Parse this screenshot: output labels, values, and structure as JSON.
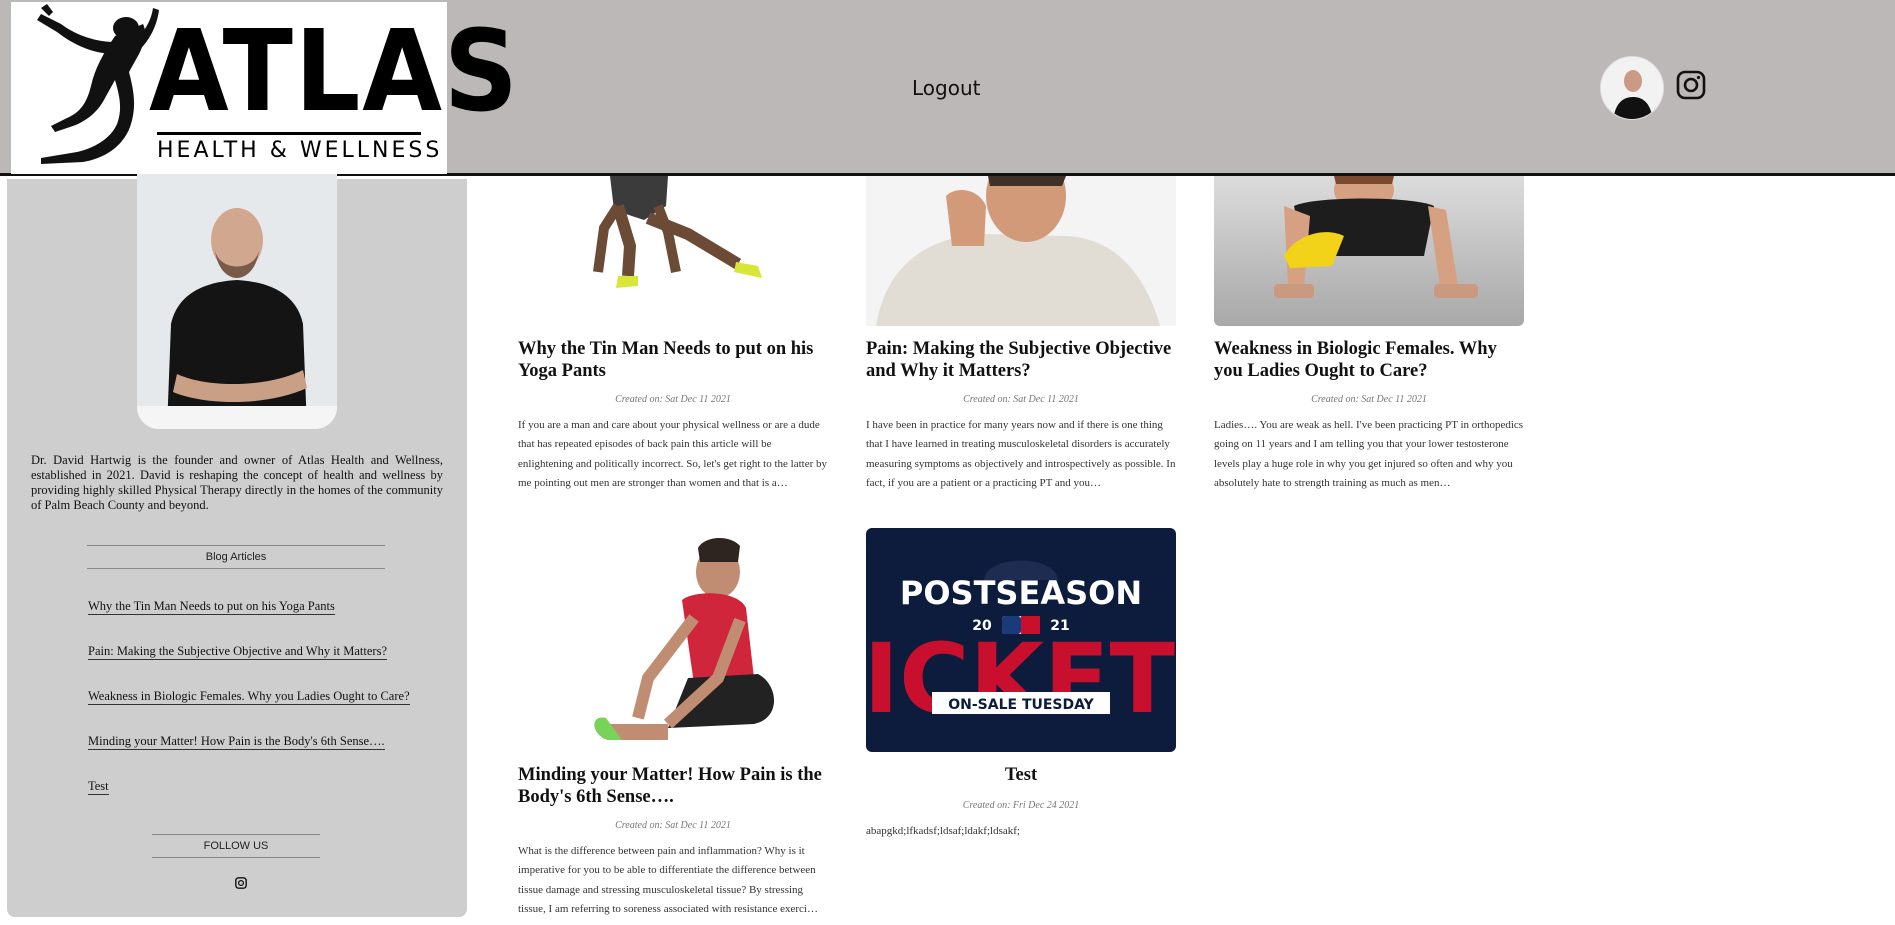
{
  "brand": {
    "name": "ATLAS",
    "tagline": "HEALTH & WELLNESS"
  },
  "header": {
    "logout_label": "Logout",
    "avatar_icon": "profile-avatar",
    "instagram_icon": "instagram-icon"
  },
  "sidebar": {
    "bio": "Dr. David Hartwig is the founder and owner of Atlas Health and Wellness, established in 2021. David is reshaping the concept of health and wellness by providing highly skilled Physical Therapy directly in the homes of the community of Palm Beach County and beyond.",
    "blog_label": "Blog Articles",
    "links": [
      "Why the Tin Man Needs to put on his Yoga Pants",
      "Pain: Making the Subjective Objective and Why it Matters?",
      "Weakness in Biologic Females. Why you Ladies Ought to Care?",
      "Minding your Matter! How Pain is the Body's 6th Sense….",
      "Test"
    ],
    "follow_label": "FOLLOW US"
  },
  "posts": [
    {
      "title": "Why the Tin Man Needs to put on his Yoga Pants",
      "date": "Created on: Sat Dec 11 2021",
      "excerpt": "If you are a man and care about your physical wellness or are a dude that has repeated episodes of back pain this article will be enlightening and politically incorrect. So, let's get right to the latter by me pointing out men are stronger than women and that is a…"
    },
    {
      "title": "Pain: Making the Subjective Objective and Why it Matters?",
      "date": "Created on: Sat Dec 11 2021",
      "excerpt": "I have been in practice for many years now and if there is one thing that I have learned in treating musculoskeletal disorders is accurately measuring symptoms as objectively and introspectively as possible. In fact, if you are a patient or a practicing PT and you…"
    },
    {
      "title": "Weakness in Biologic Females. Why you Ladies Ought to Care?",
      "date": "Created on: Sat Dec 11 2021",
      "excerpt": "Ladies…. You are weak as hell. I've been practicing PT in orthopedics going on 11 years and I am telling you that your lower testosterone levels play a huge role in why you get injured so often and why you absolutely hate to strength training as much as men…"
    },
    {
      "title": "Minding your Matter! How Pain is the Body's 6th Sense….",
      "date": "Created on: Sat Dec 11 2021",
      "excerpt": "What is the difference between pain and inflammation? Why is it imperative for you to be able to differentiate the difference between tissue damage and stressing musculoskeletal tissue? By stressing tissue, I am referring to soreness associated with resistance exerci…"
    },
    {
      "title": "Test",
      "date": "Created on: Fri Dec 24 2021",
      "excerpt": "abapgkd;lfkadsf;ldsaf;ldakf;ldsakf;",
      "image_text": {
        "headline": "POSTSEASON",
        "year_left": "20",
        "year_right": "21",
        "big": "TICKETS",
        "banner": "ON-SALE TUESDAY"
      }
    }
  ],
  "colors": {
    "header_bg": "#bcb8b7",
    "sidebar_bg": "#cecece",
    "ticket_navy": "#0d1b3d",
    "ticket_red": "#c8102e"
  }
}
